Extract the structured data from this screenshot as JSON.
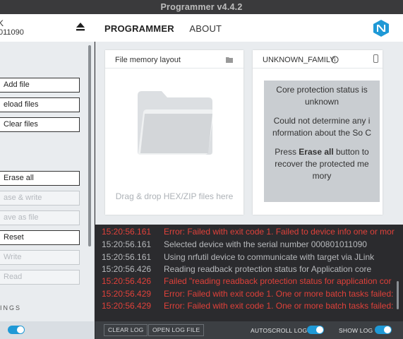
{
  "window": {
    "title": "Programmer v4.4.2"
  },
  "header": {
    "device_name": "K",
    "device_serial": "011090",
    "tabs": [
      {
        "label": "PROGRAMMER",
        "active": true
      },
      {
        "label": "ABOUT",
        "active": false
      }
    ],
    "logo_icon": "nordic-logo-icon"
  },
  "sidebar": {
    "buttons": [
      {
        "label": "Add file",
        "enabled": true
      },
      {
        "label": "eload files",
        "enabled": true
      },
      {
        "label": "Clear files",
        "enabled": true
      },
      {
        "label": "Erase all",
        "enabled": true
      },
      {
        "label": "ase & write",
        "enabled": false
      },
      {
        "label": "ave as file",
        "enabled": false
      },
      {
        "label": "Reset",
        "enabled": true
      },
      {
        "label": "Write",
        "enabled": false
      },
      {
        "label": "Read",
        "enabled": false
      }
    ],
    "section_label": "INGS",
    "toggle_on": true
  },
  "file_memory": {
    "title": "File memory layout",
    "drop_text": "Drag & drop HEX/ZIP files here"
  },
  "device_card": {
    "title": "UNKNOWN_FAMILY",
    "status_lines": [
      "Core protection status is unknown",
      "Could not determine any i nformation about the So C"
    ],
    "press_prefix": "Press ",
    "press_bold": "Erase all",
    "press_suffix": " button to recover the protected me mory"
  },
  "log": {
    "lines": [
      {
        "time": "15:20:56.161",
        "text": "Error: Failed with exit code 1. Failed to device info one or mor",
        "level": "error"
      },
      {
        "time": "15:20:56.161",
        "text": "Selected device with the serial number 000801011090",
        "level": "info"
      },
      {
        "time": "15:20:56.161",
        "text": "Using nrfutil device to communicate with target via JLink",
        "level": "info"
      },
      {
        "time": "15:20:56.426",
        "text": "Reading readback protection status for Application core",
        "level": "info"
      },
      {
        "time": "15:20:56.426",
        "text": "Failed \"reading readback protection status for application cor",
        "level": "error"
      },
      {
        "time": "15:20:56.429",
        "text": "Error: Failed with exit code 1. One or more batch tasks failed:",
        "level": "error"
      },
      {
        "time": "15:20:56.429",
        "text": "Error: Failed with exit code 1. One or more batch tasks failed:",
        "level": "error"
      }
    ]
  },
  "logbar": {
    "clear_log": "CLEAR LOG",
    "open_log_file": "OPEN LOG FILE",
    "autoscroll_label": "AUTOSCROLL LOG",
    "autoscroll_on": true,
    "show_log_label": "SHOW LOG",
    "show_log_on": true
  },
  "colors": {
    "accent": "#1f99d6",
    "error": "#e0413a"
  }
}
